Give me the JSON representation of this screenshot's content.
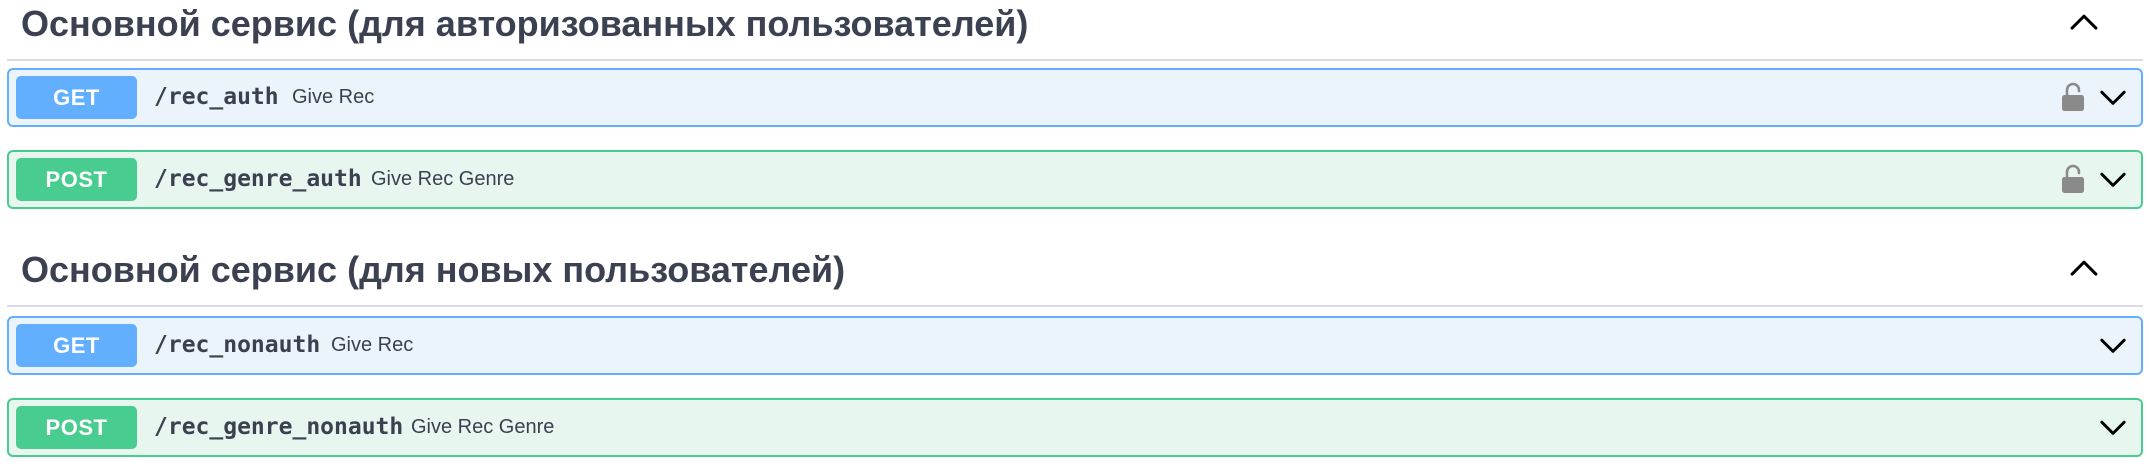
{
  "sections": [
    {
      "title": "Основной сервис (для авторизованных пользователей)",
      "expanded": true,
      "operations": [
        {
          "method": "GET",
          "path": "/rec_auth",
          "summary": "Give Rec",
          "locked": true
        },
        {
          "method": "POST",
          "path": "/rec_genre_auth",
          "summary": "Give Rec Genre",
          "locked": true
        }
      ]
    },
    {
      "title": "Основной сервис (для новых пользователей)",
      "expanded": true,
      "operations": [
        {
          "method": "GET",
          "path": "/rec_nonauth",
          "summary": "Give Rec",
          "locked": false
        },
        {
          "method": "POST",
          "path": "/rec_genre_nonauth",
          "summary": "Give Rec Genre",
          "locked": false
        }
      ]
    }
  ],
  "colors": {
    "get": "#61affe",
    "get_bg": "#ebf3fb",
    "post": "#49cc90",
    "post_bg": "#e8f6f0",
    "text": "#3b4151"
  },
  "icons": {
    "section_toggle": "chevron-up-icon",
    "operation_toggle": "chevron-down-icon",
    "auth": "unlocked-padlock-icon"
  }
}
